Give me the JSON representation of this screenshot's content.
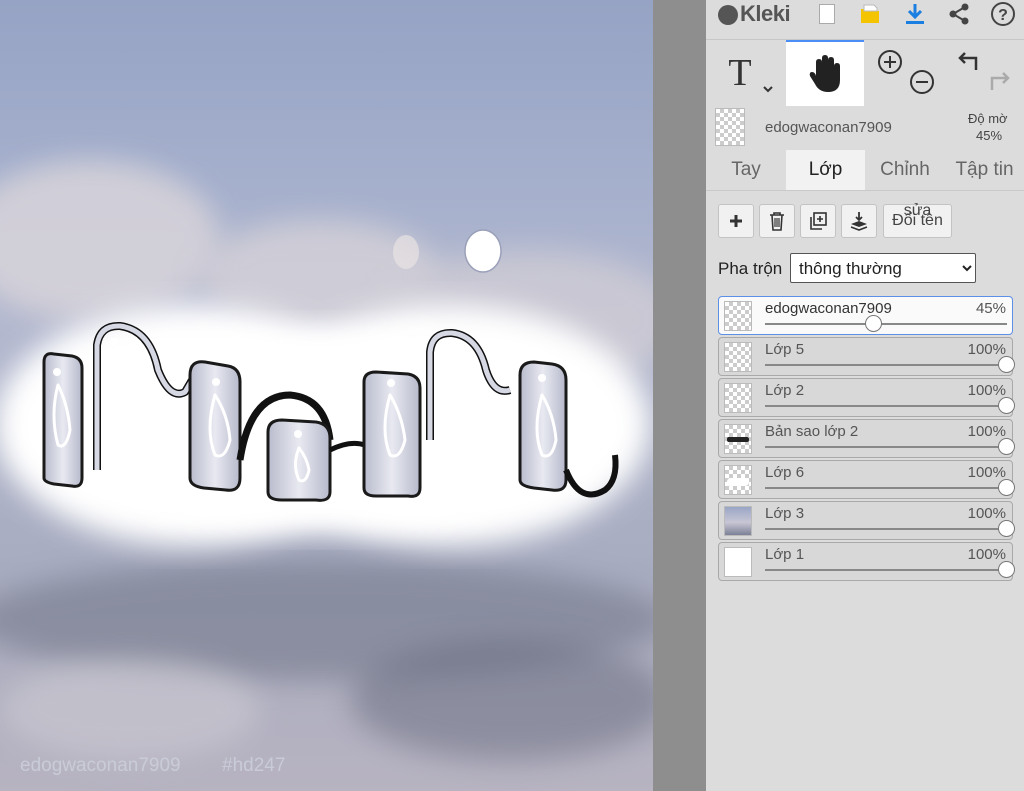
{
  "app": {
    "logo": "Kleki"
  },
  "canvas": {
    "watermark_user": "edogwaconan7909",
    "watermark_tag": "#hd247"
  },
  "toolbar": {
    "icons": [
      "new-image-icon",
      "open-folder-icon",
      "download-icon",
      "share-icon",
      "help-icon"
    ],
    "tools": [
      "text-tool-icon",
      "hand-tool-icon",
      "zoom-in-icon",
      "zoom-out-icon",
      "undo-icon",
      "redo-icon"
    ],
    "active_tool": "hand"
  },
  "layer_header": {
    "name": "edogwaconan7909",
    "opacity_label": "Độ mờ",
    "opacity_value": "45%"
  },
  "tabs": [
    {
      "label": "Tay",
      "active": false
    },
    {
      "label": "Lớp",
      "active": true
    },
    {
      "label": "Chỉnh",
      "active": false
    },
    {
      "label": "Tập tin",
      "active": false
    }
  ],
  "layer_actions": {
    "icons": [
      "add-layer-icon",
      "delete-layer-icon",
      "duplicate-layer-icon",
      "merge-down-icon"
    ],
    "rename_label_top": "sửa",
    "rename_label": "Đổi tên"
  },
  "blend": {
    "label": "Pha trộn",
    "value": "thông thường",
    "options": [
      "thông thường"
    ]
  },
  "layers": [
    {
      "name": "edogwaconan7909",
      "opacity": "45%",
      "level": 0.45,
      "active": true,
      "thumb": "checker"
    },
    {
      "name": "Lớp 5",
      "opacity": "100%",
      "level": 1.0,
      "active": false,
      "thumb": "checker"
    },
    {
      "name": "Lớp 2",
      "opacity": "100%",
      "level": 1.0,
      "active": false,
      "thumb": "checker"
    },
    {
      "name": "Bản sao lớp 2",
      "opacity": "100%",
      "level": 1.0,
      "active": false,
      "thumb": "text"
    },
    {
      "name": "Lớp 6",
      "opacity": "100%",
      "level": 1.0,
      "active": false,
      "thumb": "cloud"
    },
    {
      "name": "Lớp 3",
      "opacity": "100%",
      "level": 1.0,
      "active": false,
      "thumb": "sky"
    },
    {
      "name": "Lớp 1",
      "opacity": "100%",
      "level": 1.0,
      "active": false,
      "thumb": "white"
    }
  ],
  "colors": {
    "accent": "#4a8ef5",
    "panel_bg": "#dcdcdc",
    "download_blue": "#1a7fe0",
    "folder_yellow": "#f5c400"
  }
}
